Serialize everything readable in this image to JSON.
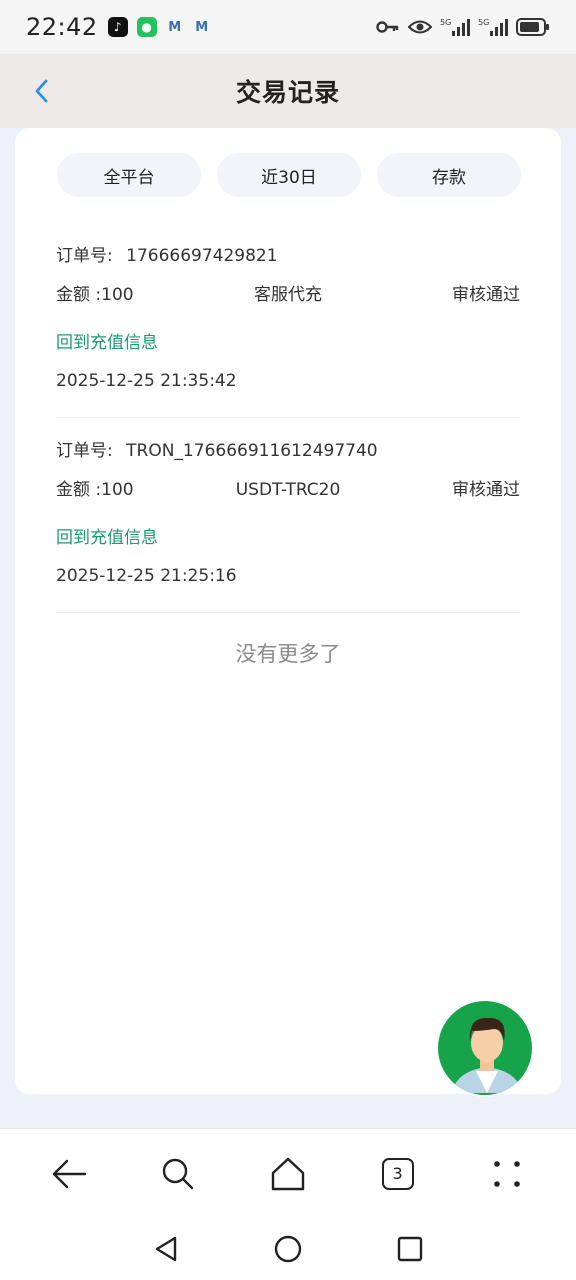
{
  "status_bar": {
    "time": "22:42",
    "apps": [
      "tiktok-icon",
      "wechat-icon",
      "gmail-icon",
      "gmail-icon"
    ],
    "signal_1": "5G",
    "signal_2": "5G"
  },
  "header": {
    "title": "交易记录",
    "back_icon": "chevron-left-icon",
    "accent_color": "#2f8ee0"
  },
  "filters": [
    {
      "label": "全平台"
    },
    {
      "label": "近30日"
    },
    {
      "label": "存款"
    }
  ],
  "records": [
    {
      "order_label": "订单号:",
      "order_no": "17666697429821",
      "amount_label": "金额 :",
      "amount": "100",
      "channel": "客服代充",
      "status": "审核通过",
      "link": "回到充值信息",
      "time": "2025-12-25 21:35:42"
    },
    {
      "order_label": "订单号:",
      "order_no": "TRON_176666911612497740",
      "amount_label": "金额 :",
      "amount": "100",
      "channel": "USDT-TRC20",
      "status": "审核通过",
      "link": "回到充值信息",
      "time": "2025-12-25 21:25:16"
    }
  ],
  "no_more": "没有更多了",
  "browser_bar": {
    "tab_count": "3"
  },
  "colors": {
    "link": "#1c9a74",
    "fab": "#16a34a"
  }
}
